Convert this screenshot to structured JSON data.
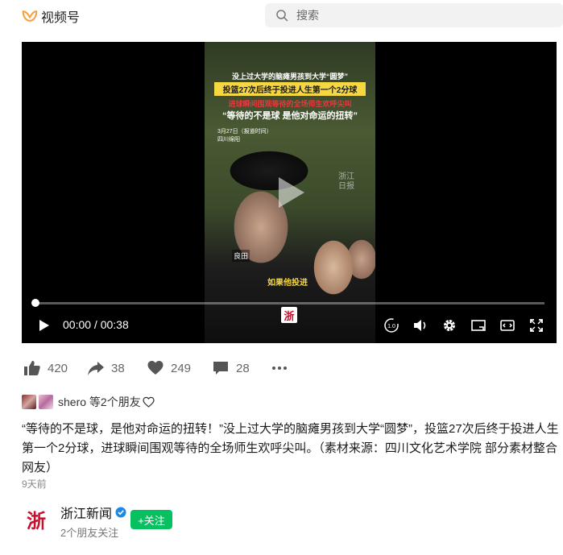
{
  "header": {
    "app_name": "视频号",
    "search_placeholder": "搜索"
  },
  "video": {
    "caption_line1": "没上过大学的脑瘫男孩到大学“圆梦”",
    "caption_line2": "投篮27次后终于投进人生第一个2分球",
    "caption_line3": "进球瞬间围观等待的全场师生欢呼尖叫",
    "caption_line4": "“等待的不是球 是他对命运的扭转”",
    "date_line": "3月27日（报道时间）",
    "location_line": "四川绵阳",
    "watermark": "浙江\n日报",
    "name_label": "良田",
    "subtitle": "如果他投进",
    "channel_logo_text": "浙",
    "current_time": "00:00",
    "duration": "00:38",
    "time_display": "00:00 / 00:38",
    "progress": 0.0,
    "speed_label": "1.0"
  },
  "actions": {
    "likes": "420",
    "shares": "38",
    "hearts": "249",
    "comments": "28"
  },
  "friends": {
    "text": "shero 等2个朋友"
  },
  "description": "“等待的不是球，是他对命运的扭转！”没上过大学的脑瘫男孩到大学“圆梦”，投篮27次后终于投进人生第一个2分球，进球瞬间围观等待的全场师生欢呼尖叫。（素材来源：四川文化艺术学院 部分素材整合网友）",
  "post_age": "9天前",
  "author": {
    "name": "浙江新闻",
    "subtext": "2个朋友关注",
    "follow_label": "+关注",
    "logo_text": "浙"
  },
  "colors": {
    "brand_orange": "#fa9d3b",
    "follow_green": "#07c160",
    "verified_blue": "#1e88e5",
    "caption_yellow": "#f5d742",
    "caption_red": "#e8383d"
  }
}
